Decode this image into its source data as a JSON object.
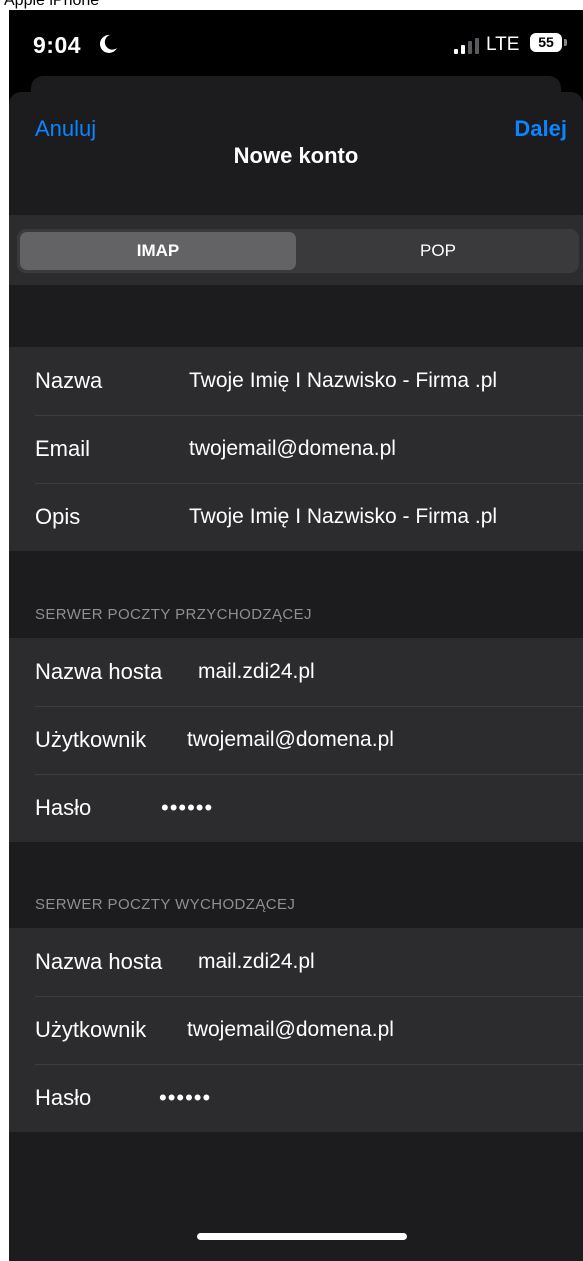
{
  "caption": "Apple iPhone",
  "status_bar": {
    "time": "9:04",
    "network": "LTE",
    "battery": "55",
    "moon_icon": "moon-icon",
    "signal_icon": "signal-bars-icon"
  },
  "nav": {
    "cancel_label": "Anuluj",
    "title": "Nowe konto",
    "next_label": "Dalej",
    "accent_color": "#0a84ff"
  },
  "segmented": {
    "options": [
      "IMAP",
      "POP"
    ],
    "selected": "IMAP"
  },
  "account": {
    "rows": [
      {
        "label": "Nazwa",
        "value": "Twoje Imię I Nazwisko - Firma .pl"
      },
      {
        "label": "Email",
        "value": "twojemail@domena.pl"
      },
      {
        "label": "Opis",
        "value": "Twoje Imię I Nazwisko - Firma .pl"
      }
    ]
  },
  "incoming": {
    "header": "SERWER POCZTY PRZYCHODZĄCEJ",
    "rows": [
      {
        "label": "Nazwa hosta",
        "value": "mail.zdi24.pl"
      },
      {
        "label": "Użytkownik",
        "value": "twojemail@domena.pl"
      },
      {
        "label": "Hasło",
        "value": "••••••"
      }
    ]
  },
  "outgoing": {
    "header": "SERWER POCZTY WYCHODZĄCEJ",
    "rows": [
      {
        "label": "Nazwa hosta",
        "value": "mail.zdi24.pl"
      },
      {
        "label": "Użytkownik",
        "value": "twojemail@domena.pl"
      },
      {
        "label": "Hasło",
        "value": "••••••"
      }
    ]
  }
}
